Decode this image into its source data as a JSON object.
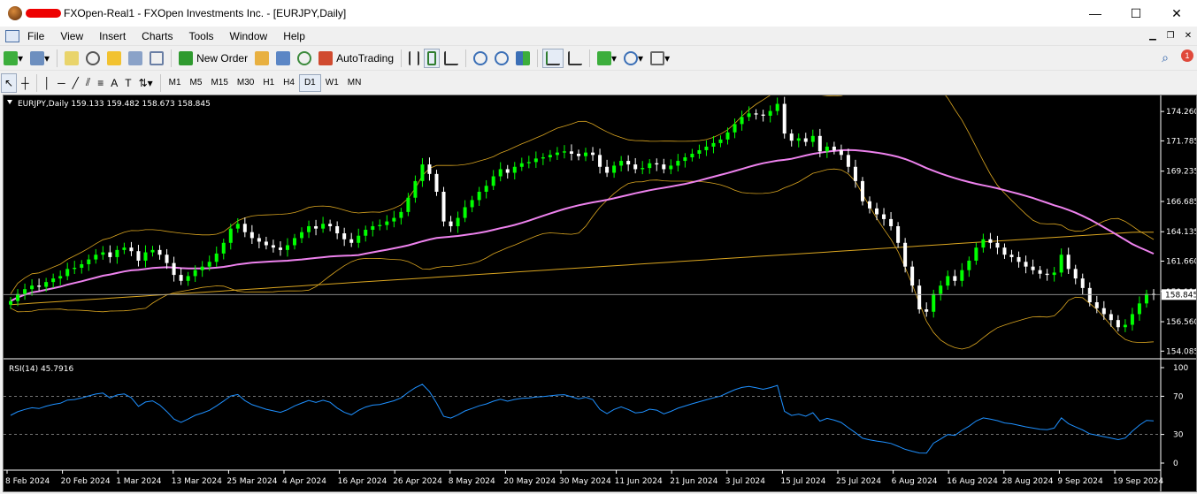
{
  "window": {
    "title": "FXOpen-Real1 - FXOpen Investments Inc. - [EURJPY,Daily]",
    "controls": [
      "—",
      "☐",
      "✕"
    ]
  },
  "menu": [
    "File",
    "View",
    "Insert",
    "Charts",
    "Tools",
    "Window",
    "Help"
  ],
  "toolbar": {
    "new_order": "New Order",
    "auto_trading": "AutoTrading",
    "notification_count": "1"
  },
  "timeframes": [
    "M1",
    "M5",
    "M15",
    "M30",
    "H1",
    "H4",
    "D1",
    "W1",
    "MN"
  ],
  "active_timeframe": "D1",
  "chart": {
    "header": "EURJPY,Daily  159.133 159.482 158.673 158.845",
    "current_price": "158.845",
    "price_ticks": [
      "174.260",
      "171.785",
      "169.235",
      "166.685",
      "164.135",
      "161.660",
      "159.110",
      "156.560",
      "154.085"
    ],
    "rsi_label": "RSI(14) 45.7916",
    "rsi_ticks": [
      "100",
      "70",
      "30",
      "0"
    ],
    "date_ticks": [
      "8 Feb 2024",
      "20 Feb 2024",
      "1 Mar 2024",
      "13 Mar 2024",
      "25 Mar 2024",
      "4 Apr 2024",
      "16 Apr 2024",
      "26 Apr 2024",
      "8 May 2024",
      "20 May 2024",
      "30 May 2024",
      "11 Jun 2024",
      "21 Jun 2024",
      "3 Jul 2024",
      "15 Jul 2024",
      "25 Jul 2024",
      "6 Aug 2024",
      "16 Aug 2024",
      "28 Aug 2024",
      "9 Sep 2024",
      "19 Sep 2024"
    ],
    "colors": {
      "background": "#000000",
      "bull": "#00ff00",
      "bear": "#ffffff",
      "ma_fast": "#ee82ee",
      "ma_slow": "#daa520",
      "bands": "#daa520",
      "rsi": "#1e90ff"
    },
    "closes": [
      158.3,
      158.9,
      159.3,
      159.6,
      159.5,
      159.9,
      160.2,
      160.4,
      161.0,
      161.1,
      161.4,
      161.8,
      162.2,
      162.4,
      162.0,
      162.6,
      162.8,
      162.5,
      161.7,
      162.4,
      162.6,
      162.2,
      161.5,
      160.5,
      160.0,
      160.4,
      160.9,
      161.2,
      161.6,
      162.3,
      163.2,
      164.4,
      164.8,
      164.1,
      163.6,
      163.3,
      163.0,
      162.8,
      162.6,
      163.0,
      163.6,
      164.1,
      164.6,
      164.4,
      164.8,
      164.6,
      164.0,
      163.5,
      163.2,
      163.8,
      164.3,
      164.6,
      164.7,
      165.0,
      165.3,
      165.8,
      167.0,
      168.4,
      169.8,
      169.0,
      167.5,
      165.0,
      164.6,
      165.3,
      166.2,
      166.8,
      167.5,
      168.0,
      168.8,
      169.4,
      169.1,
      169.6,
      169.9,
      170.0,
      170.3,
      170.4,
      170.6,
      170.8,
      170.9,
      170.7,
      170.5,
      170.8,
      170.6,
      169.6,
      169.1,
      169.7,
      170.1,
      169.8,
      169.4,
      169.5,
      169.9,
      169.8,
      169.4,
      169.7,
      170.1,
      170.4,
      170.7,
      171.0,
      171.3,
      171.6,
      171.9,
      172.5,
      173.2,
      173.8,
      174.1,
      174.0,
      173.9,
      174.3,
      174.9,
      172.4,
      171.8,
      172.0,
      171.7,
      172.2,
      170.9,
      171.3,
      171.0,
      170.6,
      169.6,
      168.4,
      166.7,
      166.1,
      165.6,
      165.2,
      164.6,
      163.2,
      161.2,
      159.6,
      157.6,
      157.4,
      158.9,
      159.6,
      160.4,
      160.0,
      160.9,
      161.7,
      162.8,
      163.5,
      163.2,
      162.8,
      162.2,
      162.0,
      161.6,
      161.2,
      160.9,
      160.6,
      160.5,
      160.7,
      162.2,
      161.0,
      160.2,
      159.4,
      158.2,
      157.7,
      157.2,
      156.7,
      156.1,
      156.3,
      157.2,
      158.1,
      158.9,
      158.8
    ]
  }
}
